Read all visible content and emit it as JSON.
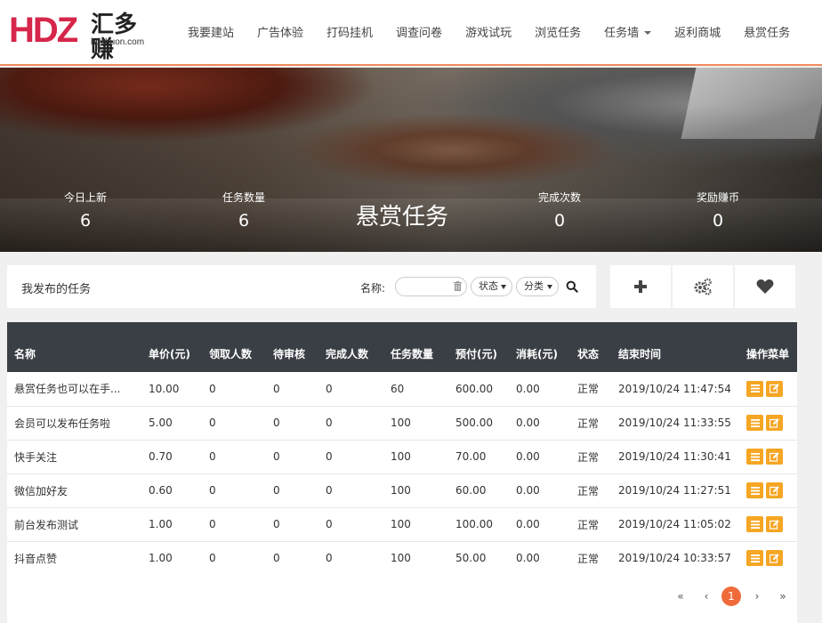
{
  "logo": {
    "mark": "HDZ",
    "name": "汇多赚",
    "url": "hdzhuon.com"
  },
  "nav": [
    {
      "label": "我要建站"
    },
    {
      "label": "广告体验"
    },
    {
      "label": "打码挂机"
    },
    {
      "label": "调查问卷"
    },
    {
      "label": "游戏试玩"
    },
    {
      "label": "浏览任务"
    },
    {
      "label": "任务墙"
    },
    {
      "label": "返利商城"
    },
    {
      "label": "悬赏任务"
    }
  ],
  "banner": {
    "title": "悬赏任务",
    "stats": [
      {
        "label": "今日上新",
        "value": "6"
      },
      {
        "label": "任务数量",
        "value": "6"
      },
      {
        "label": "完成次数",
        "value": "0"
      },
      {
        "label": "奖励赚币",
        "value": "0"
      }
    ]
  },
  "toolbar": {
    "title": "我发布的任务",
    "name_label": "名称:",
    "name_value": "",
    "status_select": "状态",
    "category_select": "分类"
  },
  "table": {
    "headers": [
      "名称",
      "单价(元)",
      "领取人数",
      "待审核",
      "完成人数",
      "任务数量",
      "预付(元)",
      "消耗(元)",
      "状态",
      "结束时间",
      "操作菜单"
    ],
    "rows": [
      [
        "悬赏任务也可以在手...",
        "10.00",
        "0",
        "0",
        "0",
        "60",
        "600.00",
        "0.00",
        "正常",
        "2019/10/24 11:47:54"
      ],
      [
        "会员可以发布任务啦",
        "5.00",
        "0",
        "0",
        "0",
        "100",
        "500.00",
        "0.00",
        "正常",
        "2019/10/24 11:33:55"
      ],
      [
        "快手关注",
        "0.70",
        "0",
        "0",
        "0",
        "100",
        "70.00",
        "0.00",
        "正常",
        "2019/10/24 11:30:41"
      ],
      [
        "微信加好友",
        "0.60",
        "0",
        "0",
        "0",
        "100",
        "60.00",
        "0.00",
        "正常",
        "2019/10/24 11:27:51"
      ],
      [
        "前台发布测试",
        "1.00",
        "0",
        "0",
        "0",
        "100",
        "100.00",
        "0.00",
        "正常",
        "2019/10/24 11:05:02"
      ],
      [
        "抖音点赞",
        "1.00",
        "0",
        "0",
        "0",
        "100",
        "50.00",
        "0.00",
        "正常",
        "2019/10/24 10:33:57"
      ]
    ]
  },
  "pagination": {
    "first": "«",
    "prev": "‹",
    "current": "1",
    "next": "›",
    "last": "»"
  },
  "colors": {
    "accent": "#f5a623",
    "header_rule": "#f08a5d",
    "table_head": "#3a3f45",
    "logo": "#d6264a",
    "page_active": "#f06a3a"
  }
}
